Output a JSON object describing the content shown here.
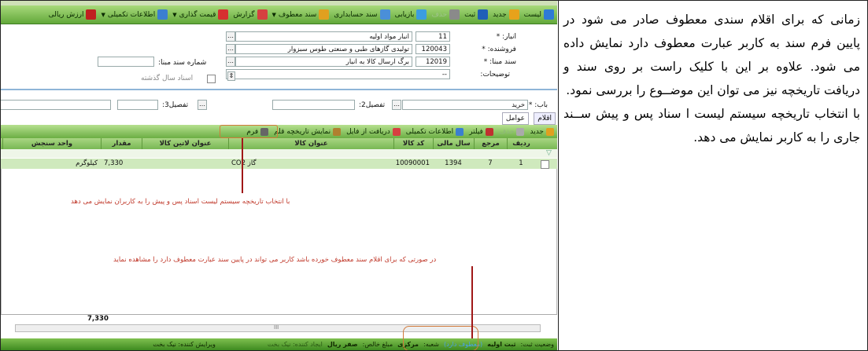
{
  "toolbar": {
    "items": [
      {
        "label": "لیست",
        "icon": "list-icon",
        "dd": false
      },
      {
        "label": "جدید",
        "icon": "new-document-icon",
        "dd": false
      },
      {
        "label": "ثبت",
        "icon": "save-icon",
        "dd": false
      },
      {
        "label": "حذف",
        "icon": "delete-icon",
        "dd": false
      },
      {
        "label": "بازیابی",
        "icon": "restore-icon",
        "dd": false
      },
      {
        "label": "سند حسابداری",
        "icon": "accounting-doc-icon",
        "dd": false
      },
      {
        "label": "سند معطوف",
        "icon": "referenced-doc-icon",
        "dd": true
      },
      {
        "label": "گزارش",
        "icon": "report-icon",
        "dd": false
      },
      {
        "label": "قیمت گذاری",
        "icon": "pricing-icon",
        "dd": true
      },
      {
        "label": "اطلاعات تکمیلی",
        "icon": "info-icon",
        "dd": true
      },
      {
        "label": "ارزش ریالی",
        "icon": "value-icon",
        "dd": false
      }
    ]
  },
  "form": {
    "warehouse_label": "انبار: *",
    "warehouse_code": "11",
    "warehouse_name": "انبار مواد اولیه",
    "supplier_label": "فروشنده: *",
    "supplier_code": "120043",
    "supplier_name": "تولیدی گازهای طبی و صنعتی طوس سبزوار",
    "basedoc_label": "سند مبنا: *",
    "basedoc_code": "12019",
    "basedoc_name": "برگ ارسال کالا به انبار",
    "desc_label": "توضیحات:",
    "desc_value": "--",
    "basedoc_no_label": "شماره سند مبنا:",
    "prev_year_label": "اسناد سال گذشته",
    "bab_label": "باب: *",
    "bab_value": "خرید",
    "detail2_label": "تفصیل2:",
    "detail3_label": "تفصیل3:"
  },
  "tabs": [
    "اقلام",
    "عوامل"
  ],
  "gridbar": {
    "items": [
      "جدید",
      "حذف",
      "فیلتر",
      "اطلاعات تکمیلی",
      "دریافت از فایل",
      "نمایش تاریخچه قلم",
      "فرم"
    ]
  },
  "grid": {
    "headers": [
      "ردیف",
      "مرجع",
      "سال مالی",
      "کد کالا",
      "عنوان کالا",
      "عنوان لاتین کالا",
      "مقدار",
      "واحد سنجش"
    ],
    "rows": [
      {
        "row": "1",
        "ref": "7",
        "year": "1394",
        "code": "10090001",
        "title": "گاز CO2",
        "latin": "",
        "qty": "7,330",
        "unit": "کیلوگرم"
      }
    ],
    "total": "7,330"
  },
  "notes": {
    "note1": "با انتخاب تاریخچه سیستم لیست اسناد پس و پیش را به کاربران نمایش می دهد",
    "note2": "در صورتی که برای اقلام سند معطوف خورده باشد کاربر می تواند در پایین سند عبارت معطوف دارد را مشاهده نماید"
  },
  "statusbar": {
    "status_label": "وضعیت ثبت:",
    "status_value": "ثبت اولیه",
    "referenced": "(معطوف دارد)",
    "branch_label": "شعبه:",
    "branch_value": "مرکزی",
    "net_label": "مبلغ خالص:",
    "net_value": "صفر ریال",
    "creator": "ایجاد کننده: نیک بخت",
    "editor": "ویرایش کننده: نیک بخت"
  },
  "text_panel": {
    "p1": "زمانی که برای اقلام سندی معطوف صادر می شود در پایین فرم سند به کاربر عبارت معطوف دارد نمایش داده می شود. علاوه بر این با کلیک راست بر روی سند و دریافت تاریخچه نیز می توان این موضــوع را بررسی نمود.",
    "p2": "با انتخاب تاریخچه  سیستم لیست ا سناد پس و پیش ســند جاری را به کاربر نمایش می دهد."
  },
  "colors": {
    "toolbar_green": "#62a83a",
    "note_red": "#c0392b",
    "highlight": "#d27a3a"
  }
}
